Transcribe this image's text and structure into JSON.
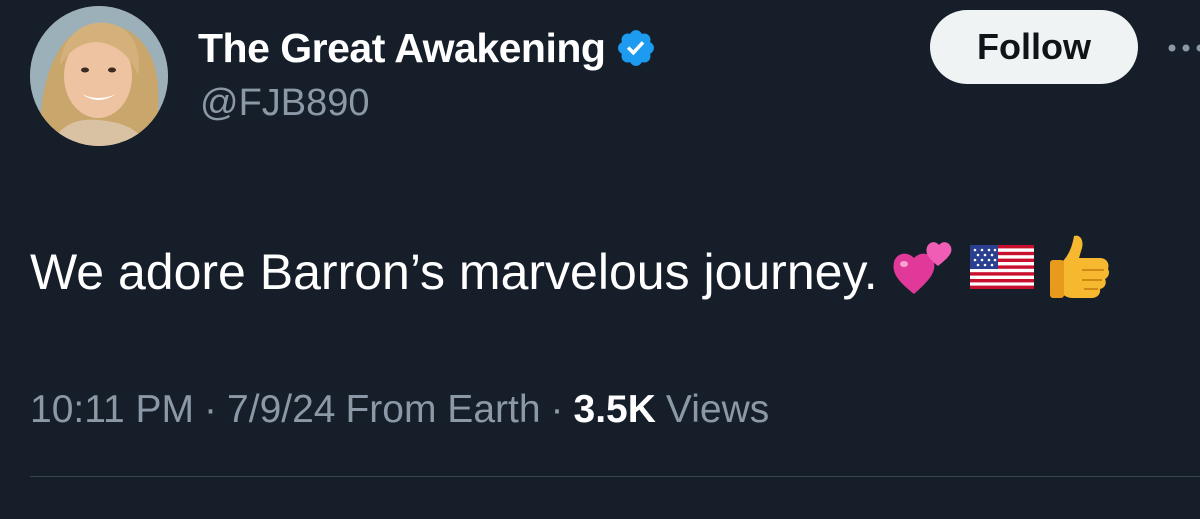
{
  "author": {
    "display_name": "The Great Awakening",
    "handle": "@FJB890",
    "verified": true,
    "avatar_icon": "profile-photo"
  },
  "actions": {
    "follow_label": "Follow",
    "more_icon": "more-dots-icon"
  },
  "tweet": {
    "text": "We adore Barron’s marvelous journey.",
    "emojis": [
      "two-hearts-icon",
      "us-flag-icon",
      "thumbs-up-icon"
    ]
  },
  "meta": {
    "time": "10:11 PM",
    "separator": "·",
    "date": "7/9/24",
    "source": "From Earth",
    "views_count": "3.5K",
    "views_label": "Views"
  },
  "colors": {
    "background": "#161e2a",
    "text": "#ffffff",
    "secondary_text": "#8b98a5",
    "verified_blue": "#1d9bf0",
    "follow_bg": "#eff3f4",
    "divider": "#38444d"
  }
}
